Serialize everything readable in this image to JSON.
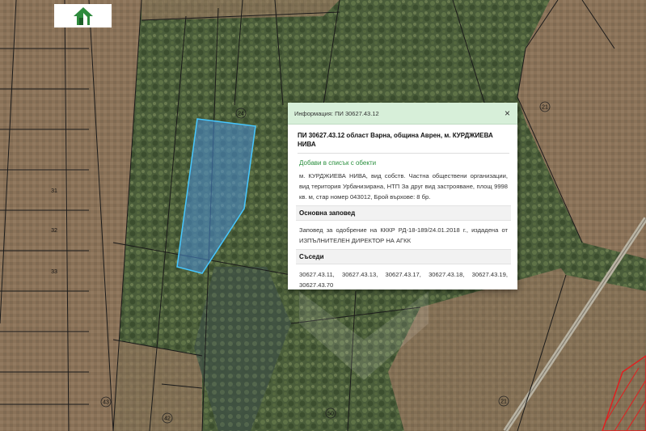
{
  "map": {
    "parcel_labels": [
      "24",
      "31",
      "32",
      "33",
      "43",
      "42",
      "50",
      "21",
      "21"
    ],
    "colors": {
      "highlight_fill": "#4a8fd8",
      "highlight_stroke": "#46c7ff",
      "parcel_lines": "#1a1a1a",
      "popup_header": "#d7efd9",
      "link": "#2a8f3e"
    }
  },
  "logo": {
    "icon": "house-logo-icon"
  },
  "popup": {
    "title": "Информация: ПИ 30627.43.12",
    "close_label": "×",
    "heading": "ПИ 30627.43.12 област Варна, община Аврен, м. КУРДЖИЕВА НИВА",
    "add_link": "Добави в списък с обекти",
    "description": "м. КУРДЖИЕВА НИВА, вид собств. Частна обществени организации, вид територия Урбанизирана, НТП За друг вид застрояване, площ 9998 кв. м, стар номер 043012, Брой върхове: 8 бр.",
    "order_heading": "Основна заповед",
    "order_text": "Заповед за одобрение на КККР РД-18-189/24.01.2018 г., издадена от ИЗПЪЛНИТЕЛЕН ДИРЕКТОР НА АГКК",
    "neighbors_heading": "Съседи",
    "neighbors": [
      "30627.43.11,",
      "30627.43.13,",
      "30627.43.17,",
      "30627.43.18,",
      "30627.43.19,",
      "30627.43.70"
    ]
  }
}
